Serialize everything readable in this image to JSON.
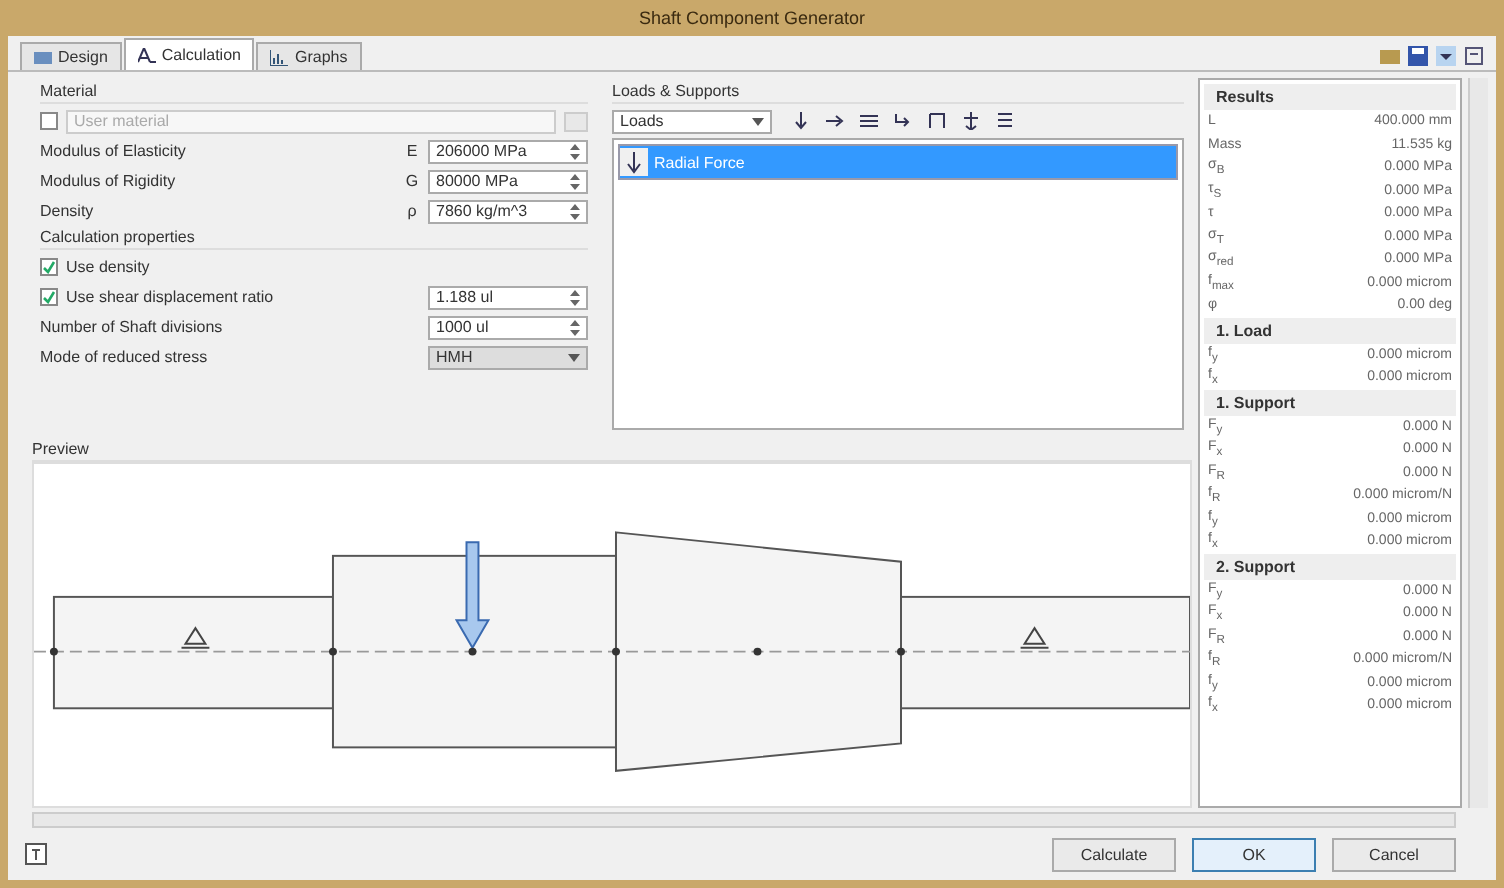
{
  "window": {
    "title": "Shaft Component Generator"
  },
  "tabs": [
    {
      "label": "Design",
      "selected": false
    },
    {
      "label": "Calculation",
      "selected": true
    },
    {
      "label": "Graphs",
      "selected": false
    }
  ],
  "material": {
    "title": "Material",
    "user_material": {
      "label": "User material",
      "checked": false
    },
    "properties": [
      {
        "label": "Modulus of Elasticity",
        "symbol": "E",
        "value": "206000 MPa"
      },
      {
        "label": "Modulus of Rigidity",
        "symbol": "G",
        "value": "80000 MPa"
      },
      {
        "label": "Density",
        "symbol": "ρ",
        "value": "7860 kg/m^3"
      }
    ]
  },
  "calculation_properties": {
    "title": "Calculation properties",
    "items": [
      {
        "kind": "checkbox",
        "label": "Use density",
        "checked": true
      },
      {
        "kind": "checkbox",
        "label": "Use shear displacement ratio",
        "checked": true,
        "value": "1.188 ul"
      },
      {
        "kind": "field",
        "label": "Number of Shaft divisions",
        "value": "1000 ul"
      },
      {
        "kind": "select",
        "label": "Mode of reduced stress",
        "value": "HMH"
      }
    ]
  },
  "loads": {
    "title": "Loads & Supports",
    "dropdown": "Loads",
    "items": [
      {
        "label": "Radial Force",
        "selected": true
      }
    ]
  },
  "preview": {
    "title": "Preview"
  },
  "results": {
    "title": "Results",
    "rows": [
      {
        "label": "L",
        "value": "400.000 mm"
      },
      {
        "label": "Mass",
        "value": "11.535 kg"
      },
      {
        "label": "σ$_{B}$",
        "value": "0.000 MPa"
      },
      {
        "label": "τ$_{S}$",
        "value": "0.000 MPa"
      },
      {
        "label": "τ",
        "value": "0.000 MPa"
      },
      {
        "label": "σ$_{T}$",
        "value": "0.000 MPa"
      },
      {
        "label": "σ$_{red}$",
        "value": "0.000 MPa"
      },
      {
        "label": "f$_{max}$",
        "value": "0.000 microm"
      },
      {
        "label": "φ",
        "value": "0.00 deg"
      }
    ],
    "sections": [
      {
        "title": "1. Load",
        "rows": [
          {
            "label": "f$_{y}$",
            "value": "0.000 microm"
          },
          {
            "label": "f$_{x}$",
            "value": "0.000 microm"
          }
        ]
      },
      {
        "title": "1. Support",
        "rows": [
          {
            "label": "F$_{y}$",
            "value": "0.000 N"
          },
          {
            "label": "F$_{x}$",
            "value": "0.000 N"
          },
          {
            "label": "F$_{R}$",
            "value": "0.000 N"
          },
          {
            "label": "f$_{R}$",
            "value": "0.000 microm/N"
          },
          {
            "label": "f$_{y}$",
            "value": "0.000 microm"
          },
          {
            "label": "f$_{x}$",
            "value": "0.000 microm"
          }
        ]
      },
      {
        "title": "2. Support",
        "rows": [
          {
            "label": "F$_{y}$",
            "value": "0.000 N"
          },
          {
            "label": "F$_{x}$",
            "value": "0.000 N"
          },
          {
            "label": "F$_{R}$",
            "value": "0.000 N"
          },
          {
            "label": "f$_{R}$",
            "value": "0.000 microm/N"
          },
          {
            "label": "f$_{y}$",
            "value": "0.000 microm"
          },
          {
            "label": "f$_{x}$",
            "value": "0.000 microm"
          }
        ]
      }
    ]
  },
  "buttons": [
    {
      "label": "Calculate",
      "kind": "normal"
    },
    {
      "label": "OK",
      "kind": "default"
    },
    {
      "label": "Cancel",
      "kind": "normal"
    }
  ]
}
